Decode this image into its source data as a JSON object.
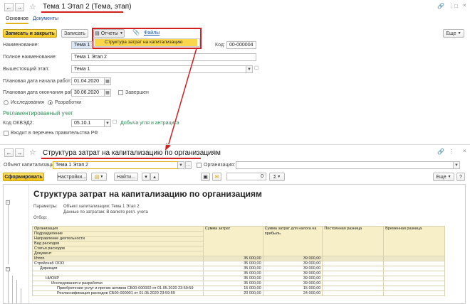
{
  "top_window": {
    "title": "Тема 1 Этап 2 (Тема, этап)",
    "tabs": [
      "Основное",
      "Документы"
    ],
    "toolbar": {
      "save_close": "Записать и закрыть",
      "save": "Записать",
      "reports": "Отчеты",
      "files": "Файлы",
      "more": "Еще"
    },
    "report_menu_item": "Структура затрат на капитализацию",
    "fields": {
      "name_label": "Наименование:",
      "name_value": "Тема 1 Эт",
      "code_label": "Код:",
      "code_value": "00-000004",
      "full_name_label": "Полное наименование:",
      "full_name_value": "Тема 1 Этап 2",
      "parent_label": "Вышестоящий этап:",
      "parent_value": "Тема 1",
      "start_label": "Плановая дата начала работ:",
      "start_value": "01.04.2020",
      "end_label": "Плановая дата окончания работ:",
      "end_value": "30.06.2020",
      "completed_label": "Завершен",
      "radio_research": "Исследования",
      "radio_development": "Разработки",
      "section_regulated": "Регламентированный учет",
      "okved_label": "Код ОКВЭД2:",
      "okved_value": "05.10.1",
      "okved_desc": "Добыча угля и антрацита",
      "gov_list_label": "Входит в перечень правительства РФ"
    }
  },
  "bottom_window": {
    "title": "Структура затрат на капитализацию по организациям",
    "object_label": "Объект капитализации:",
    "object_value": "Тема 1 Этап 2",
    "org_label": "Организация:",
    "toolbar": {
      "generate": "Сформировать",
      "settings": "Настройки...",
      "find": "Найти...",
      "counter": "0",
      "sigma": "Σ",
      "more": "Еще"
    },
    "report": {
      "heading": "Структура затрат на капитализацию по организациям",
      "params_label": "Параметры:",
      "param1": "Объект капитализации: Тема 1 Этап 2",
      "param2": "Данные по затратам: В валюте регл. учета",
      "filter_label": "Отбор:",
      "group_headers": [
        "Организация",
        "Подразделение",
        "Направление деятельности",
        "Вид расходов",
        "Статья расходов",
        "Документ"
      ],
      "columns": [
        "Сумма затрат",
        "Сумма затрат для налога на прибыль",
        "Постоянная разница",
        "Временная разница"
      ],
      "total_label": "Итого",
      "rows": [
        {
          "label": "Итого",
          "cost": "35 000,00",
          "tax": "39 000,00",
          "indent": 0
        },
        {
          "label": "Стройснаб ООО",
          "cost": "35 000,00",
          "tax": "39 000,00",
          "indent": 0
        },
        {
          "label": "Дирекция",
          "cost": "35 000,00",
          "tax": "39 000,00",
          "indent": 1
        },
        {
          "label": "",
          "cost": "35 000,00",
          "tax": "39 000,00",
          "indent": 2
        },
        {
          "label": "НИОКР",
          "cost": "35 000,00",
          "tax": "39 000,00",
          "indent": 2
        },
        {
          "label": "Исследования и разработки",
          "cost": "35 000,00",
          "tax": "39 000,00",
          "indent": 3
        },
        {
          "label": "Приобретение услуг и прочих активов СБ00-000002 от 01.05.2020 23:59:59",
          "cost": "15 000,00",
          "tax": "15 000,00",
          "indent": 4
        },
        {
          "label": "Реклассификация расходов СБ00-000001 от 01.05.2020 23:59:59",
          "cost": "20 000,00",
          "tax": "24 000,00",
          "indent": 4
        }
      ]
    }
  },
  "colors": {
    "accent_yellow": "#f5c518",
    "highlight_red": "#d21f1f",
    "link_blue": "#1a52a8",
    "section_green": "#2e8b57"
  }
}
